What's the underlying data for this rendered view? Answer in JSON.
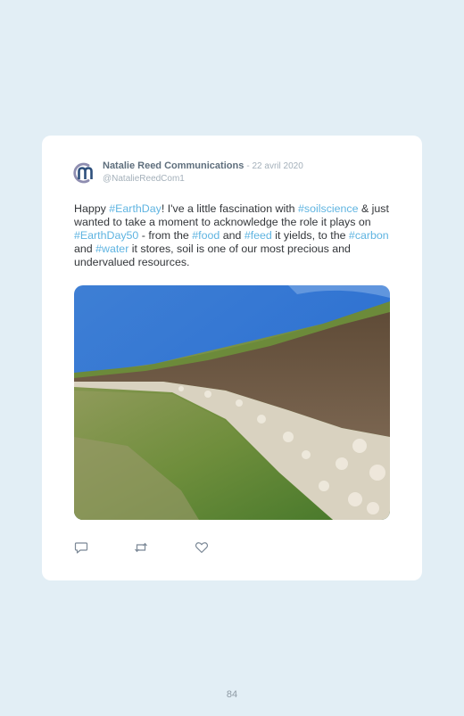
{
  "tweet": {
    "author": "Natalie Reed Communications",
    "date": "- 22 avril 2020",
    "handle": "@NatalieReedCom1",
    "text": {
      "t0": "Happy ",
      "h1": "#EarthDay",
      "t1": "! I've a little fascination with ",
      "h2": "#soilscience",
      "t2": " & just wanted to take a moment to acknowledge the role it plays on ",
      "h3": "#EarthDay50",
      "t3": " - from the ",
      "h4": "#food",
      "t4": " and ",
      "h5": "#feed",
      "t5": " it yields, to the ",
      "h6": "#carbon",
      "t6": " and ",
      "h7": "#water",
      "t7": " it stores, soil is one of our most precious and undervalued resources."
    },
    "actions": {
      "reply_icon": "reply-icon",
      "retweet_icon": "retweet-icon",
      "like_icon": "heart-icon"
    }
  },
  "page_number": "84",
  "colors": {
    "background": "#e2eef5",
    "hashtag": "#5fb4e1",
    "author": "#5e6e7c",
    "muted": "#a4b0ba"
  }
}
